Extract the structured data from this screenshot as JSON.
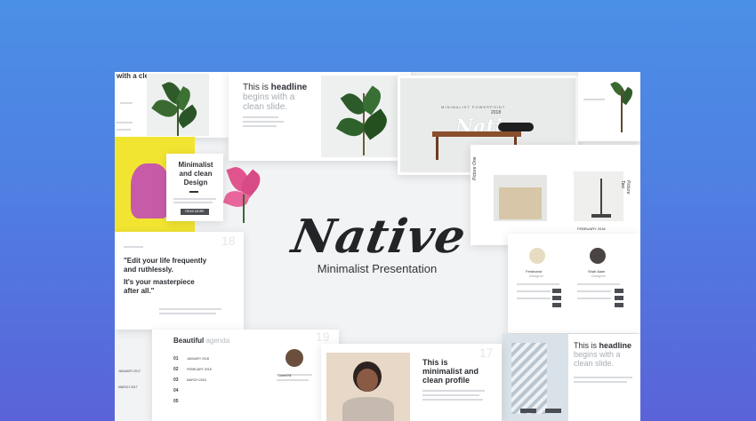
{
  "top_left_slide": {
    "headline": "with a clean"
  },
  "headline_slide": {
    "headline_prefix": "This is ",
    "headline_bold": "headline",
    "headline_line2": "begins with a",
    "headline_line3": "clean slide."
  },
  "cover_slide": {
    "caption": "MINIMALIST POWERPOINT",
    "year": "2018",
    "script": "Native"
  },
  "design_slide": {
    "title": "Minimalist and clean Design",
    "button": "READ MORE"
  },
  "center": {
    "brand": "Native",
    "subtitle": "Minimalist Presentation"
  },
  "quote_slide": {
    "number": "18",
    "quote_line1": "\"Edit your life frequently",
    "quote_line2": "and ruthlessly.",
    "quote_line3": "It's your masterpiece",
    "quote_line4": "after all.\""
  },
  "team_slide": {
    "member1": {
      "name": "Ferdinand",
      "role": "Designer"
    },
    "member2": {
      "name": "Shah Alam",
      "role": "Designer"
    }
  },
  "agenda_slide": {
    "number": "19",
    "title_bold": "Beautiful",
    "title_light": " agenda",
    "rows": [
      "01",
      "02",
      "03",
      "04",
      "05"
    ],
    "months": [
      "JANUARY 2018",
      "FEBRUARY 2018",
      "MARCH 2018"
    ],
    "side_dates": [
      "JANUARY 2017",
      "MARCH 2017"
    ]
  },
  "profile_slide": {
    "number": "17",
    "title_line1": "This is",
    "title_line2": "minimalist and",
    "title_line3": "clean profile",
    "member_name": "Lionel Kit"
  },
  "bottom_right_slide": {
    "headline_prefix": "This is ",
    "headline_bold": "headline",
    "headline_line2": "begins with a",
    "headline_line3": "clean slide."
  },
  "photo_slide": {
    "label_left": "Picture One",
    "label_right": "Picture Two",
    "date": "FEBRUARY 2018"
  },
  "colors": {
    "background_top": "#4a8fe6",
    "background_bottom": "#5a63d8",
    "yellow_accent": "#f2e531",
    "text_dark": "#222428"
  }
}
